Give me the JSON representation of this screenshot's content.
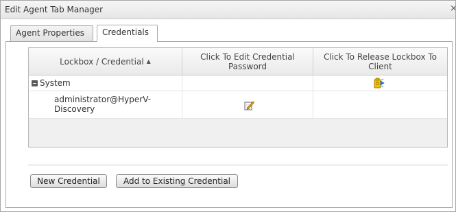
{
  "window": {
    "title": "Edit Agent Tab Manager",
    "close_glyph": "×"
  },
  "tabs": [
    {
      "label": "Agent Properties",
      "active": false
    },
    {
      "label": "Credentials",
      "active": true
    }
  ],
  "grid": {
    "columns": [
      {
        "label": "Lockbox / Credential",
        "sort": "ascending"
      },
      {
        "label": "Click To Edit Credential Password"
      },
      {
        "label": "Click To Release Lockbox To Client"
      }
    ],
    "rows": [
      {
        "label": "System",
        "type": "group",
        "expanded": true,
        "icon": "release-lockbox-icon"
      },
      {
        "label": "administrator@HyperV-Discovery",
        "type": "credential",
        "icon": "edit-pencil-icon"
      }
    ]
  },
  "buttons": {
    "new_credential": "New Credential",
    "add_existing": "Add to Existing Credential"
  },
  "colors": {
    "window_border": "#a6a6a6",
    "grid_background": "#f0f0f0",
    "lockbox_icon": "#f2c200",
    "pencil_icon": "#e8a800"
  }
}
